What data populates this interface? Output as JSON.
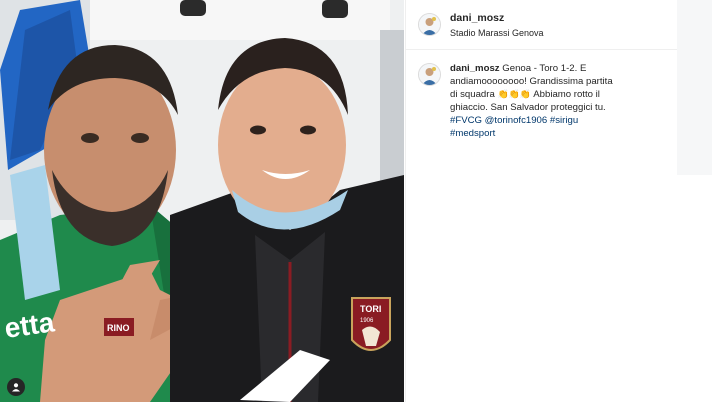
{
  "post": {
    "username": "dani_mosz",
    "location": "Stadio Marassi Genova"
  },
  "caption": {
    "username": "dani_mosz",
    "text_1": "Genoa - Toro 1-2. E andiamoooooooo! Grandissima partita di squadra",
    "emoji": "👏👏👏",
    "text_2": "Abbiamo rotto il ghiaccio. San Salvador proteggici tu.",
    "hashtags": [
      "#FVCG",
      "@torinofc1906",
      "#sirigu",
      "#medsport"
    ]
  },
  "photo_text": {
    "shirt_left": "etta",
    "badge_right": "TORI",
    "badge_year": "1906",
    "badge_left": "RINO"
  },
  "icons": {
    "user_overlay": "user-icon",
    "avatar": "avatar-icon"
  },
  "colors": {
    "link": "#00376b",
    "text": "#262626",
    "torino_maroon": "#8a1c23",
    "green_shirt": "#1f8a4c"
  }
}
